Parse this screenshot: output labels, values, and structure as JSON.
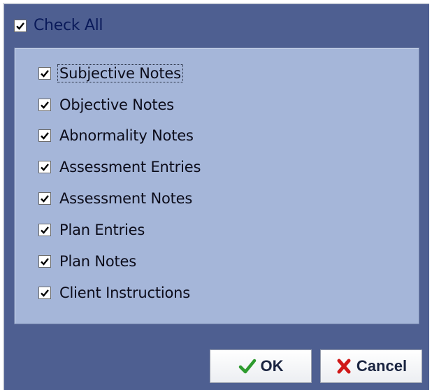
{
  "check_all": {
    "label": "Check All",
    "checked": true
  },
  "items": [
    {
      "label": "Subjective Notes",
      "checked": true
    },
    {
      "label": "Objective Notes",
      "checked": true
    },
    {
      "label": "Abnormality Notes",
      "checked": true
    },
    {
      "label": "Assessment Entries",
      "checked": true
    },
    {
      "label": "Assessment Notes",
      "checked": true
    },
    {
      "label": "Plan Entries",
      "checked": true
    },
    {
      "label": "Plan Notes",
      "checked": true
    },
    {
      "label": "Client Instructions",
      "checked": true
    }
  ],
  "buttons": {
    "ok_label": "OK",
    "ok_icon": "green-checkmark-icon",
    "cancel_label": "Cancel",
    "cancel_icon": "red-x-icon"
  },
  "colors": {
    "dialog_bg": "#4e5f91",
    "panel_bg": "#a5b6d9",
    "ok_icon": "#2e9b2e",
    "cancel_icon": "#d01818"
  }
}
